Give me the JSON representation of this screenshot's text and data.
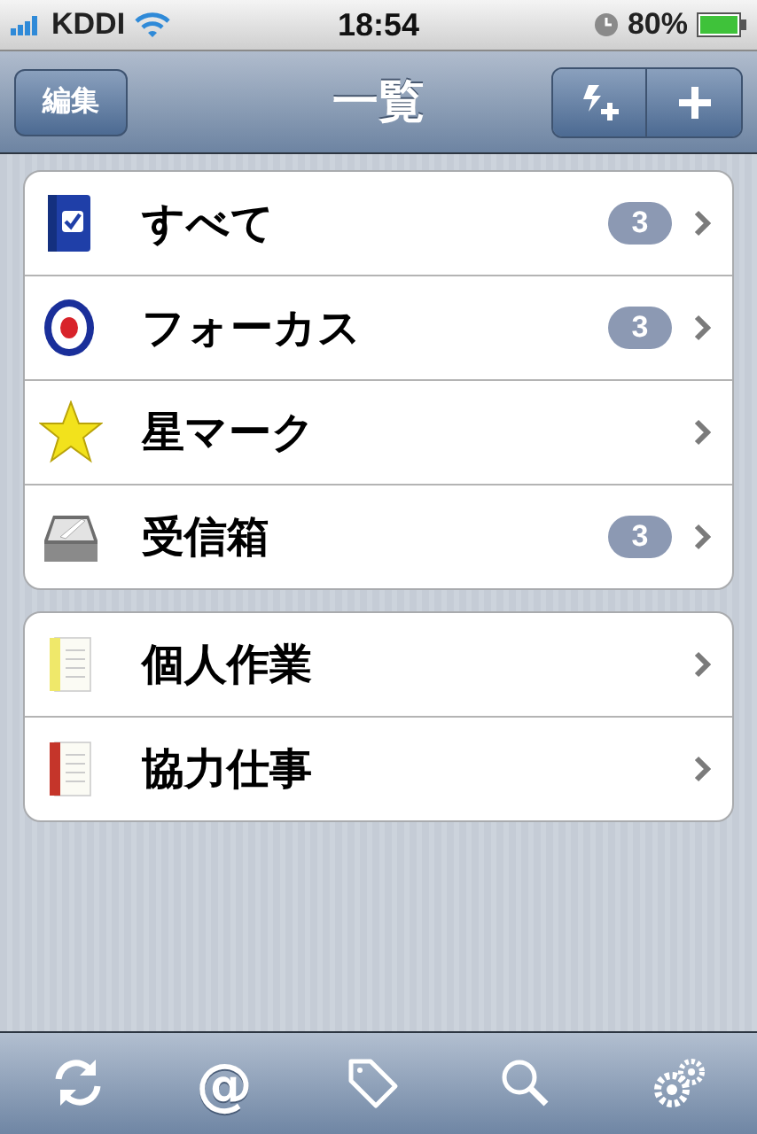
{
  "status_bar": {
    "carrier": "KDDI",
    "time": "18:54",
    "battery": "80%"
  },
  "nav_bar": {
    "edit_button": "編集",
    "title": "一覧"
  },
  "groups": [
    {
      "items": [
        {
          "label": "すべて",
          "kind": "book",
          "count": "3"
        },
        {
          "label": "フォーカス",
          "kind": "target",
          "count": "3"
        },
        {
          "label": "星マーク",
          "kind": "star"
        },
        {
          "label": "受信箱",
          "kind": "inbox",
          "count": "3"
        }
      ]
    },
    {
      "items": [
        {
          "label": "個人作業",
          "kind": "notebook",
          "color": "#efe86a"
        },
        {
          "label": "協力仕事",
          "kind": "notebook",
          "color": "#c5352a"
        }
      ]
    }
  ],
  "toolbar": [
    {
      "kind": "sync"
    },
    {
      "kind": "at",
      "label": "@"
    },
    {
      "kind": "tag"
    },
    {
      "kind": "search"
    },
    {
      "kind": "settings"
    }
  ]
}
